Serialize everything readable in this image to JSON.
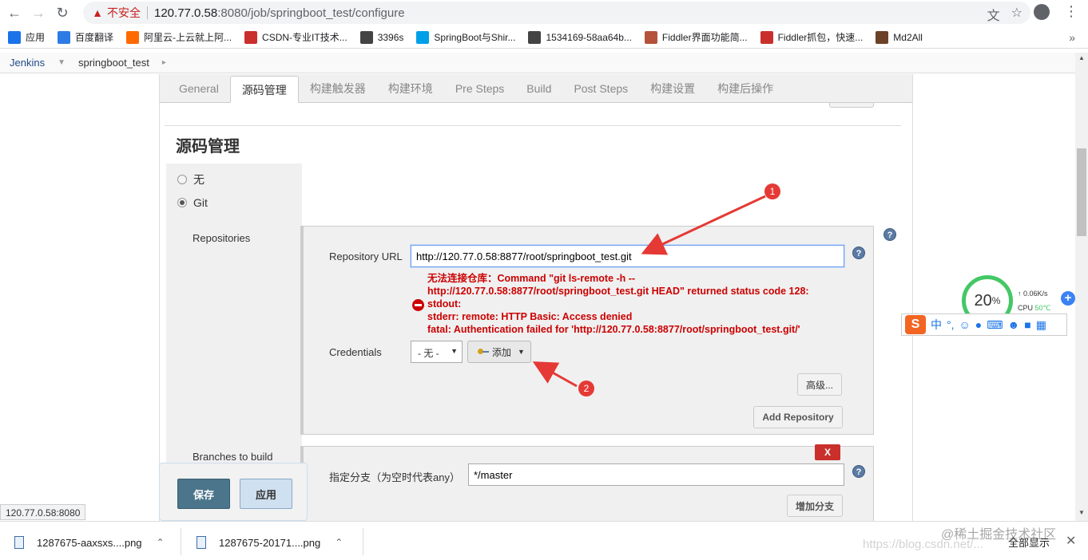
{
  "browser": {
    "insecure_label": "不安全",
    "url_host": "120.77.0.58",
    "url_path": ":8080/job/springboot_test/configure"
  },
  "bookmarks": [
    {
      "label": "应用",
      "color": "#1a73e8"
    },
    {
      "label": "百度翻译",
      "color": "#2d7be5"
    },
    {
      "label": "阿里云-上云就上阿...",
      "color": "#ff6a00"
    },
    {
      "label": "CSDN-专业IT技术...",
      "color": "#c9302c"
    },
    {
      "label": "3396s",
      "color": "#444444"
    },
    {
      "label": "SpringBoot与Shir...",
      "color": "#00a0e9"
    },
    {
      "label": "1534169-58aa64b...",
      "color": "#444444"
    },
    {
      "label": "Fiddler界面功能简...",
      "color": "#b5523b"
    },
    {
      "label": "Fiddler抓包，快速...",
      "color": "#c9302c"
    },
    {
      "label": "Md2All",
      "color": "#6b4226"
    }
  ],
  "breadcrumb": {
    "jenkins": "Jenkins",
    "job": "springboot_test"
  },
  "tabs": [
    "General",
    "源码管理",
    "构建触发器",
    "构建环境",
    "Pre Steps",
    "Build",
    "Post Steps",
    "构建设置",
    "构建后操作"
  ],
  "section": {
    "title": "源码管理",
    "radio_none": "无",
    "radio_git": "Git"
  },
  "repositories": {
    "label": "Repositories",
    "url_label": "Repository URL",
    "url_value": "http://120.77.0.58:8877/root/springboot_test.git",
    "error_lines": [
      "无法连接仓库：Command \"git ls-remote -h --",
      "http://120.77.0.58:8877/root/springboot_test.git HEAD\" returned status code 128:",
      "stdout:",
      "stderr: remote: HTTP Basic: Access denied",
      "fatal: Authentication failed for 'http://120.77.0.58:8877/root/springboot_test.git/'"
    ],
    "credentials_label": "Credentials",
    "credentials_value": "- 无 -",
    "add_label": "添加",
    "advanced_label": "高级...",
    "add_repo_label": "Add Repository"
  },
  "branches": {
    "label": "Branches to build",
    "delete_label": "X",
    "spec_label": "指定分支（为空时代表any）",
    "spec_value": "*/master",
    "add_branch_label": "增加分支"
  },
  "actions": {
    "save": "保存",
    "apply": "应用"
  },
  "status_url": "120.77.0.58:8080",
  "annotations": {
    "one": "1",
    "two": "2"
  },
  "speed_widget": {
    "percent": "20",
    "percent_unit": "%",
    "net_speed": "0.06K/s",
    "cpu_label": "CPU",
    "cpu_temp": "50℃"
  },
  "ime": {
    "logo": "S",
    "mode": "中"
  },
  "downloads": [
    {
      "name": "1287675-aaxsxs....png"
    },
    {
      "name": "1287675-20171....png"
    }
  ],
  "downloads_show_all": "全部显示",
  "watermark": "@稀土掘金技术社区",
  "watermark_url": "https://blog.csdn.net/..."
}
